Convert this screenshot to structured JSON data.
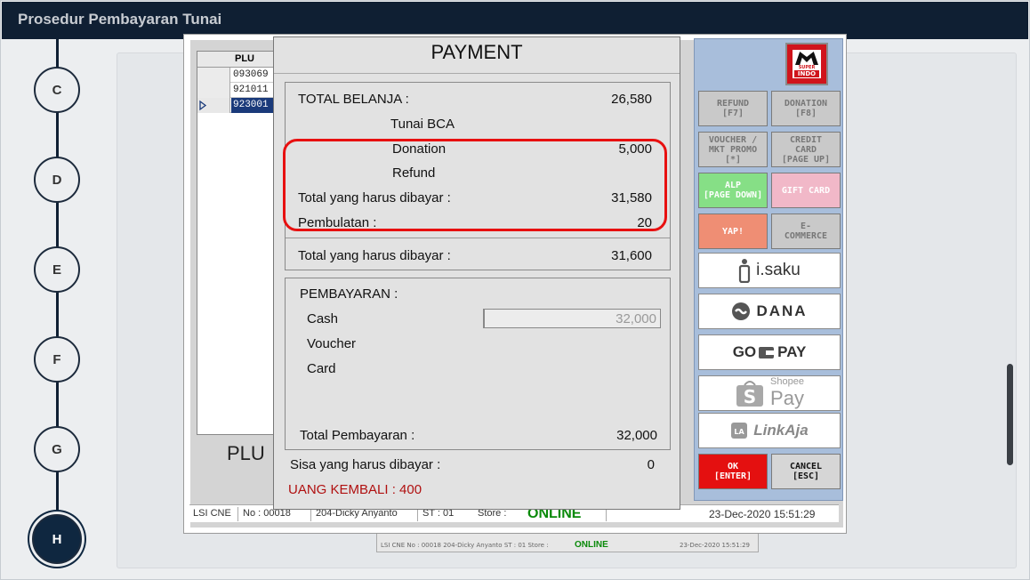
{
  "slide": {
    "title": "Prosedur Pembayaran Tunai",
    "steps": [
      "C",
      "D",
      "E",
      "F",
      "G",
      "H"
    ],
    "active_step": "H"
  },
  "pos": {
    "plu_table": {
      "header": "PLU",
      "rows": [
        "093069",
        "921011",
        "923001"
      ],
      "selected_row": 2,
      "big_label": "PLU"
    },
    "payment": {
      "title": "PAYMENT",
      "total_belanja_label": "TOTAL BELANJA :",
      "total_belanja_value": "26,580",
      "tunai_bca_label": "Tunai BCA",
      "donation_label": "Donation",
      "donation_value": "5,000",
      "refund_label": "Refund",
      "total_harus_dibayar_label": "Total yang harus dibayar :",
      "total_harus_dibayar_value": "31,580",
      "pembulatan_label": "Pembulatan :",
      "pembulatan_value": "20",
      "total_harus_dibayar2_label": "Total yang harus dibayar :",
      "total_harus_dibayar2_value": "31,600",
      "pembayaran_label": "PEMBAYARAN :",
      "cash_label": "Cash",
      "cash_value": "32,000",
      "voucher_label": "Voucher",
      "card_label": "Card",
      "total_pembayaran_label": "Total Pembayaran :",
      "total_pembayaran_value": "32,000",
      "sisa_label": "Sisa yang harus dibayar :",
      "sisa_value": "0",
      "kembali_text": "UANG KEMBALI : 400",
      "kembali_color": "#b01010"
    },
    "buttons": {
      "logo_text_super": "SUPER",
      "logo_text_indo": "INDO",
      "refund": "REFUND\n[F7]",
      "donation": "DONATION\n[F8]",
      "voucher": "VOUCHER /\nMKT PROMO\n[*]",
      "credit_card": "CREDIT\nCARD\n[PAGE UP]",
      "alp": "ALP\n[PAGE DOWN]",
      "gift_card": "GIFT CARD",
      "yap": "YAP!",
      "ecommerce": "E-\nCOMMERCE",
      "isaku": "i.saku",
      "dana": "DANA",
      "gopay_go": "GO",
      "gopay_pay": "PAY",
      "shopee_small": "Shopee",
      "shopee_pay": "Pay",
      "linkaja": "LinkAja",
      "ok": "OK\n[ENTER]",
      "cancel": "CANCEL\n[ESC]"
    },
    "status_bar": {
      "store_code": "LSI CNE",
      "no_label": "No : 00018",
      "cashier": "204-Dicky Anyanto",
      "st": "ST : 01",
      "store_label": "Store :",
      "online": "ONLINE",
      "datetime": "23-Dec-2020 15:51:29"
    },
    "ghost_strip": {
      "left_text": "LSI CNE  No : 00018  204-Dicky Anyanto  ST : 01  Store :",
      "online": "ONLINE",
      "datetime": "23-Dec-2020 15:51:29"
    }
  },
  "colors": {
    "topbar": "#0f1f33",
    "highlight": "#e81010",
    "online": "#0a8a0a",
    "ok_button": "#e41010"
  }
}
